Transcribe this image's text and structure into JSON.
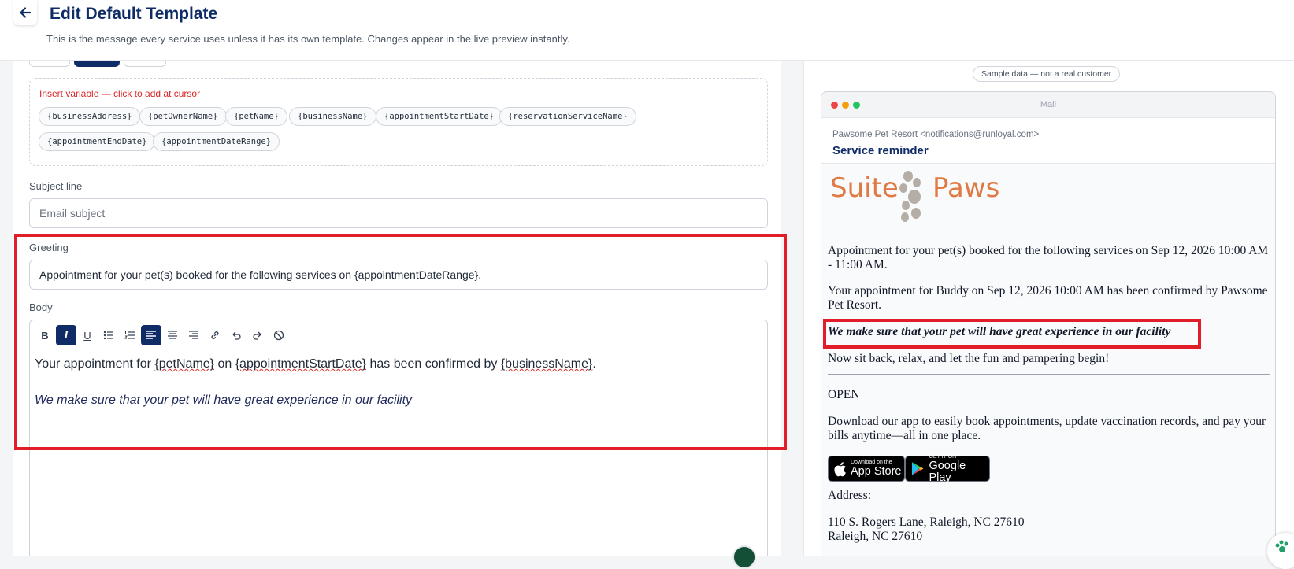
{
  "header": {
    "title": "Edit Default Template",
    "subtitle": "This is the message every service uses unless it has its own template. Changes appear in the live preview instantly."
  },
  "variables": {
    "title": "Insert variable — click to add at cursor",
    "chips": [
      "{businessAddress}",
      "{petOwnerName}",
      "{petName}",
      "{businessName}",
      "{appointmentStartDate}",
      "{reservationServiceName}",
      "{appointmentEndDate}",
      "{appointmentDateRange}"
    ]
  },
  "subject": {
    "label": "Subject line",
    "placeholder": "Email subject"
  },
  "greeting": {
    "label": "Greeting",
    "value": "Appointment for your pet(s) booked for the following services on {appointmentDateRange}."
  },
  "body": {
    "label": "Body",
    "toolbar": {
      "bold": "B",
      "italic": "I",
      "underline": "U"
    },
    "line1_before": "Your appointment for ",
    "line1_var1": "{petName}",
    "line1_mid1": " on ",
    "line1_var2": "{appointmentStartDate}",
    "line1_mid2": " has been confirmed by ",
    "line1_var3": "{businessName}",
    "line1_after": ".",
    "line2": "We make sure that your pet will have great experience in our facility"
  },
  "preview": {
    "badge": "Sample data — not a real customer",
    "window_title": "Mail",
    "from": "Pawsome Pet Resort <notifications@runloyal.com>",
    "subject": "Service reminder",
    "logo_left": "Suite",
    "logo_right": "Paws",
    "para1": "Appointment for your pet(s) booked for the following services on Sep 12, 2026 10:00 AM - 11:00 AM.",
    "para2": "Your appointment for Buddy on Sep 12, 2026 10:00 AM has been confirmed by Pawsome Pet Resort.",
    "para3": "We make sure that your pet will have great experience in our facility",
    "para4": "Now sit back, relax, and let the fun and pampering begin!",
    "open": "OPEN",
    "download": "Download our app to easily book appointments, update vaccination records, and pay your bills anytime—all in one place.",
    "app_store": {
      "small": "Download on the",
      "big": "App Store"
    },
    "google_play": {
      "small": "GET IT ON",
      "big": "Google Play"
    },
    "address_label": "Address:",
    "address_line1": "110 S. Rogers Lane, Raleigh, NC 27610",
    "address_line2": "Raleigh, NC 27610"
  },
  "colors": {
    "brand_navy": "#0f2c67",
    "highlight_red": "#e11d2a",
    "logo_orange": "#e07a44"
  }
}
